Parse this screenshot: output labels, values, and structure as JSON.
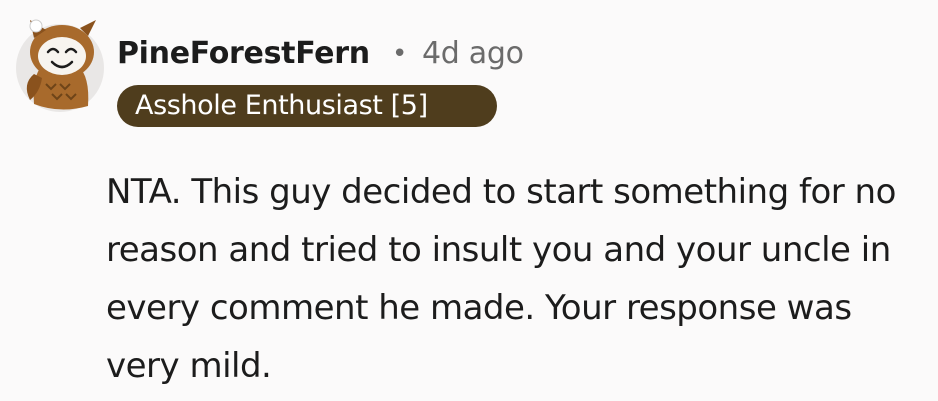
{
  "comment": {
    "author": "PineForestFern",
    "separator": "•",
    "timestamp": "4d ago",
    "flair": "Asshole Enthusiast [5]",
    "body": "NTA. This guy decided to start something for no reason and tried to insult you and your uncle in every comment he made. Your response was very mild."
  },
  "colors": {
    "flair_background": "#4f3d1d",
    "flair_text": "#ffffff",
    "meta_text": "#6b6b6b",
    "page_background": "#fbfafa"
  },
  "icons": {
    "avatar": "owl-avatar-icon"
  }
}
